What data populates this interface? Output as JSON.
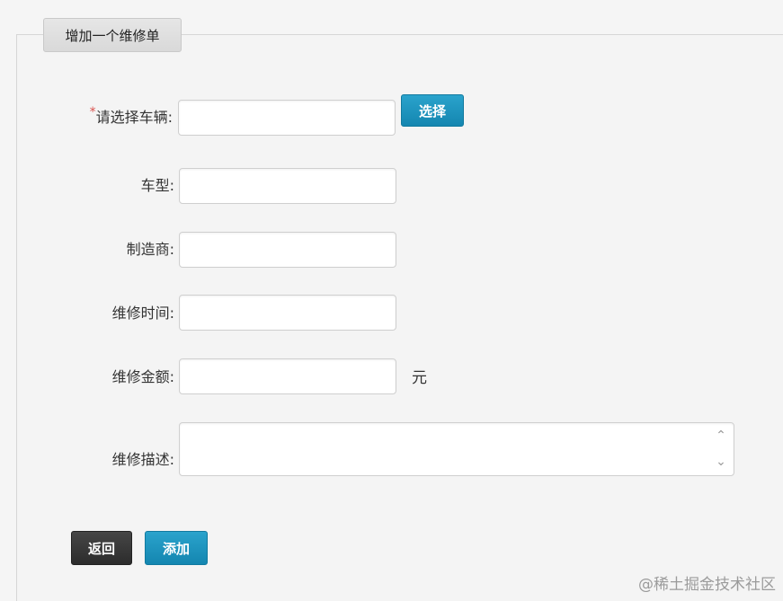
{
  "tab_title": "增加一个维修单",
  "form": {
    "vehicle": {
      "required_mark": "*",
      "label": "请选择车辆:",
      "value": "",
      "button": "选择"
    },
    "model": {
      "label": "车型:",
      "value": ""
    },
    "manufacturer": {
      "label": "制造商:",
      "value": ""
    },
    "repair_time": {
      "label": "维修时间:",
      "value": ""
    },
    "repair_amount": {
      "label": "维修金额:",
      "value": "",
      "unit": "元"
    },
    "repair_desc": {
      "label": "维修描述:",
      "value": ""
    }
  },
  "actions": {
    "back": "返回",
    "add": "添加"
  },
  "watermark": "@稀土掘金技术社区",
  "colors": {
    "primary": "#1a8fb9",
    "dark": "#333333",
    "required": "#d9534f"
  }
}
